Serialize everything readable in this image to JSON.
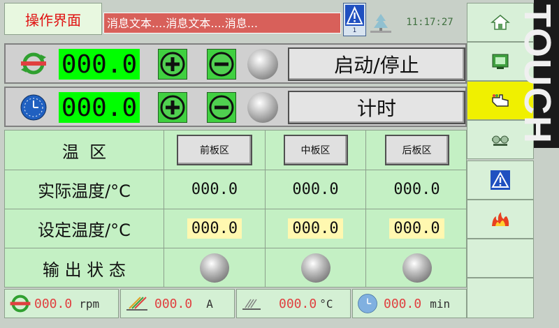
{
  "header": {
    "title": "操作界面",
    "marquee": "消息文本....消息文本....消息...",
    "alarm_count": "1",
    "clock": "11:17:27"
  },
  "touch_label": "TOUCH",
  "speed_row": {
    "value": "000.0",
    "plus": "+",
    "minus": "−",
    "action_label": "启动/停止"
  },
  "timer_row": {
    "value": "000.0",
    "plus": "+",
    "minus": "−",
    "action_label": "计时"
  },
  "zones": {
    "header_label": "温  区",
    "columns": [
      "前板区",
      "中板区",
      "后板区"
    ],
    "actual_label": "实际温度/°C",
    "actual_values": [
      "000.0",
      "000.0",
      "000.0"
    ],
    "set_label": "设定温度/°C",
    "set_values": [
      "000.0",
      "000.0",
      "000.0"
    ],
    "output_label": "输 出 状 态"
  },
  "footer": {
    "rpm_value": "000.0",
    "rpm_unit": "rpm",
    "amp_value": "000.0",
    "amp_unit": "A",
    "temp_value": "000.0",
    "temp_unit": "°C",
    "time_value": "000.0",
    "time_unit": "min"
  },
  "nav_icons": [
    "home-icon",
    "screen-icon",
    "hand-point-icon",
    "settings-icon",
    "warning-icon",
    "fire-icon"
  ],
  "colors": {
    "lcd_green": "#00ff00",
    "panel_green": "#c4f0c4",
    "active_yellow": "#f0f000",
    "title_red": "#e01010",
    "footer_value_red": "#e04040"
  }
}
